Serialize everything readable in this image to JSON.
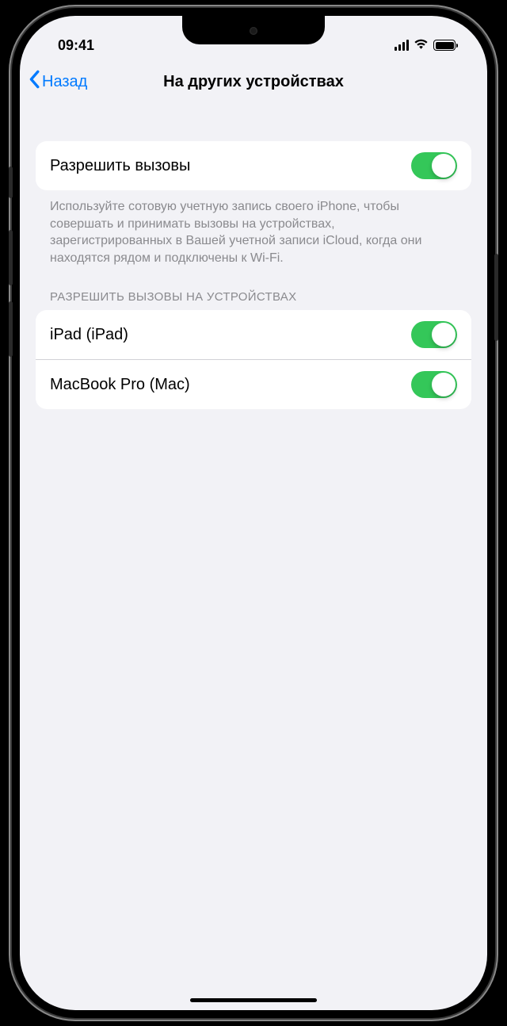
{
  "statusBar": {
    "time": "09:41"
  },
  "nav": {
    "back": "Назад",
    "title": "На других устройствах"
  },
  "allowCalls": {
    "label": "Разрешить вызовы",
    "enabled": true,
    "footer": "Используйте сотовую учетную запись своего iPhone, чтобы совершать и принимать вызовы на устройствах, зарегистрированных в Вашей учетной записи iCloud, когда они находятся рядом и подключены к Wi-Fi."
  },
  "devicesSection": {
    "header": "РАЗРЕШИТЬ ВЫЗОВЫ НА УСТРОЙСТВАХ",
    "devices": [
      {
        "label": "iPad (iPad)",
        "enabled": true
      },
      {
        "label": "MacBook Pro (Mac)",
        "enabled": true
      }
    ]
  },
  "colors": {
    "accent": "#007aff",
    "toggleOn": "#34c759",
    "background": "#f2f2f6"
  }
}
